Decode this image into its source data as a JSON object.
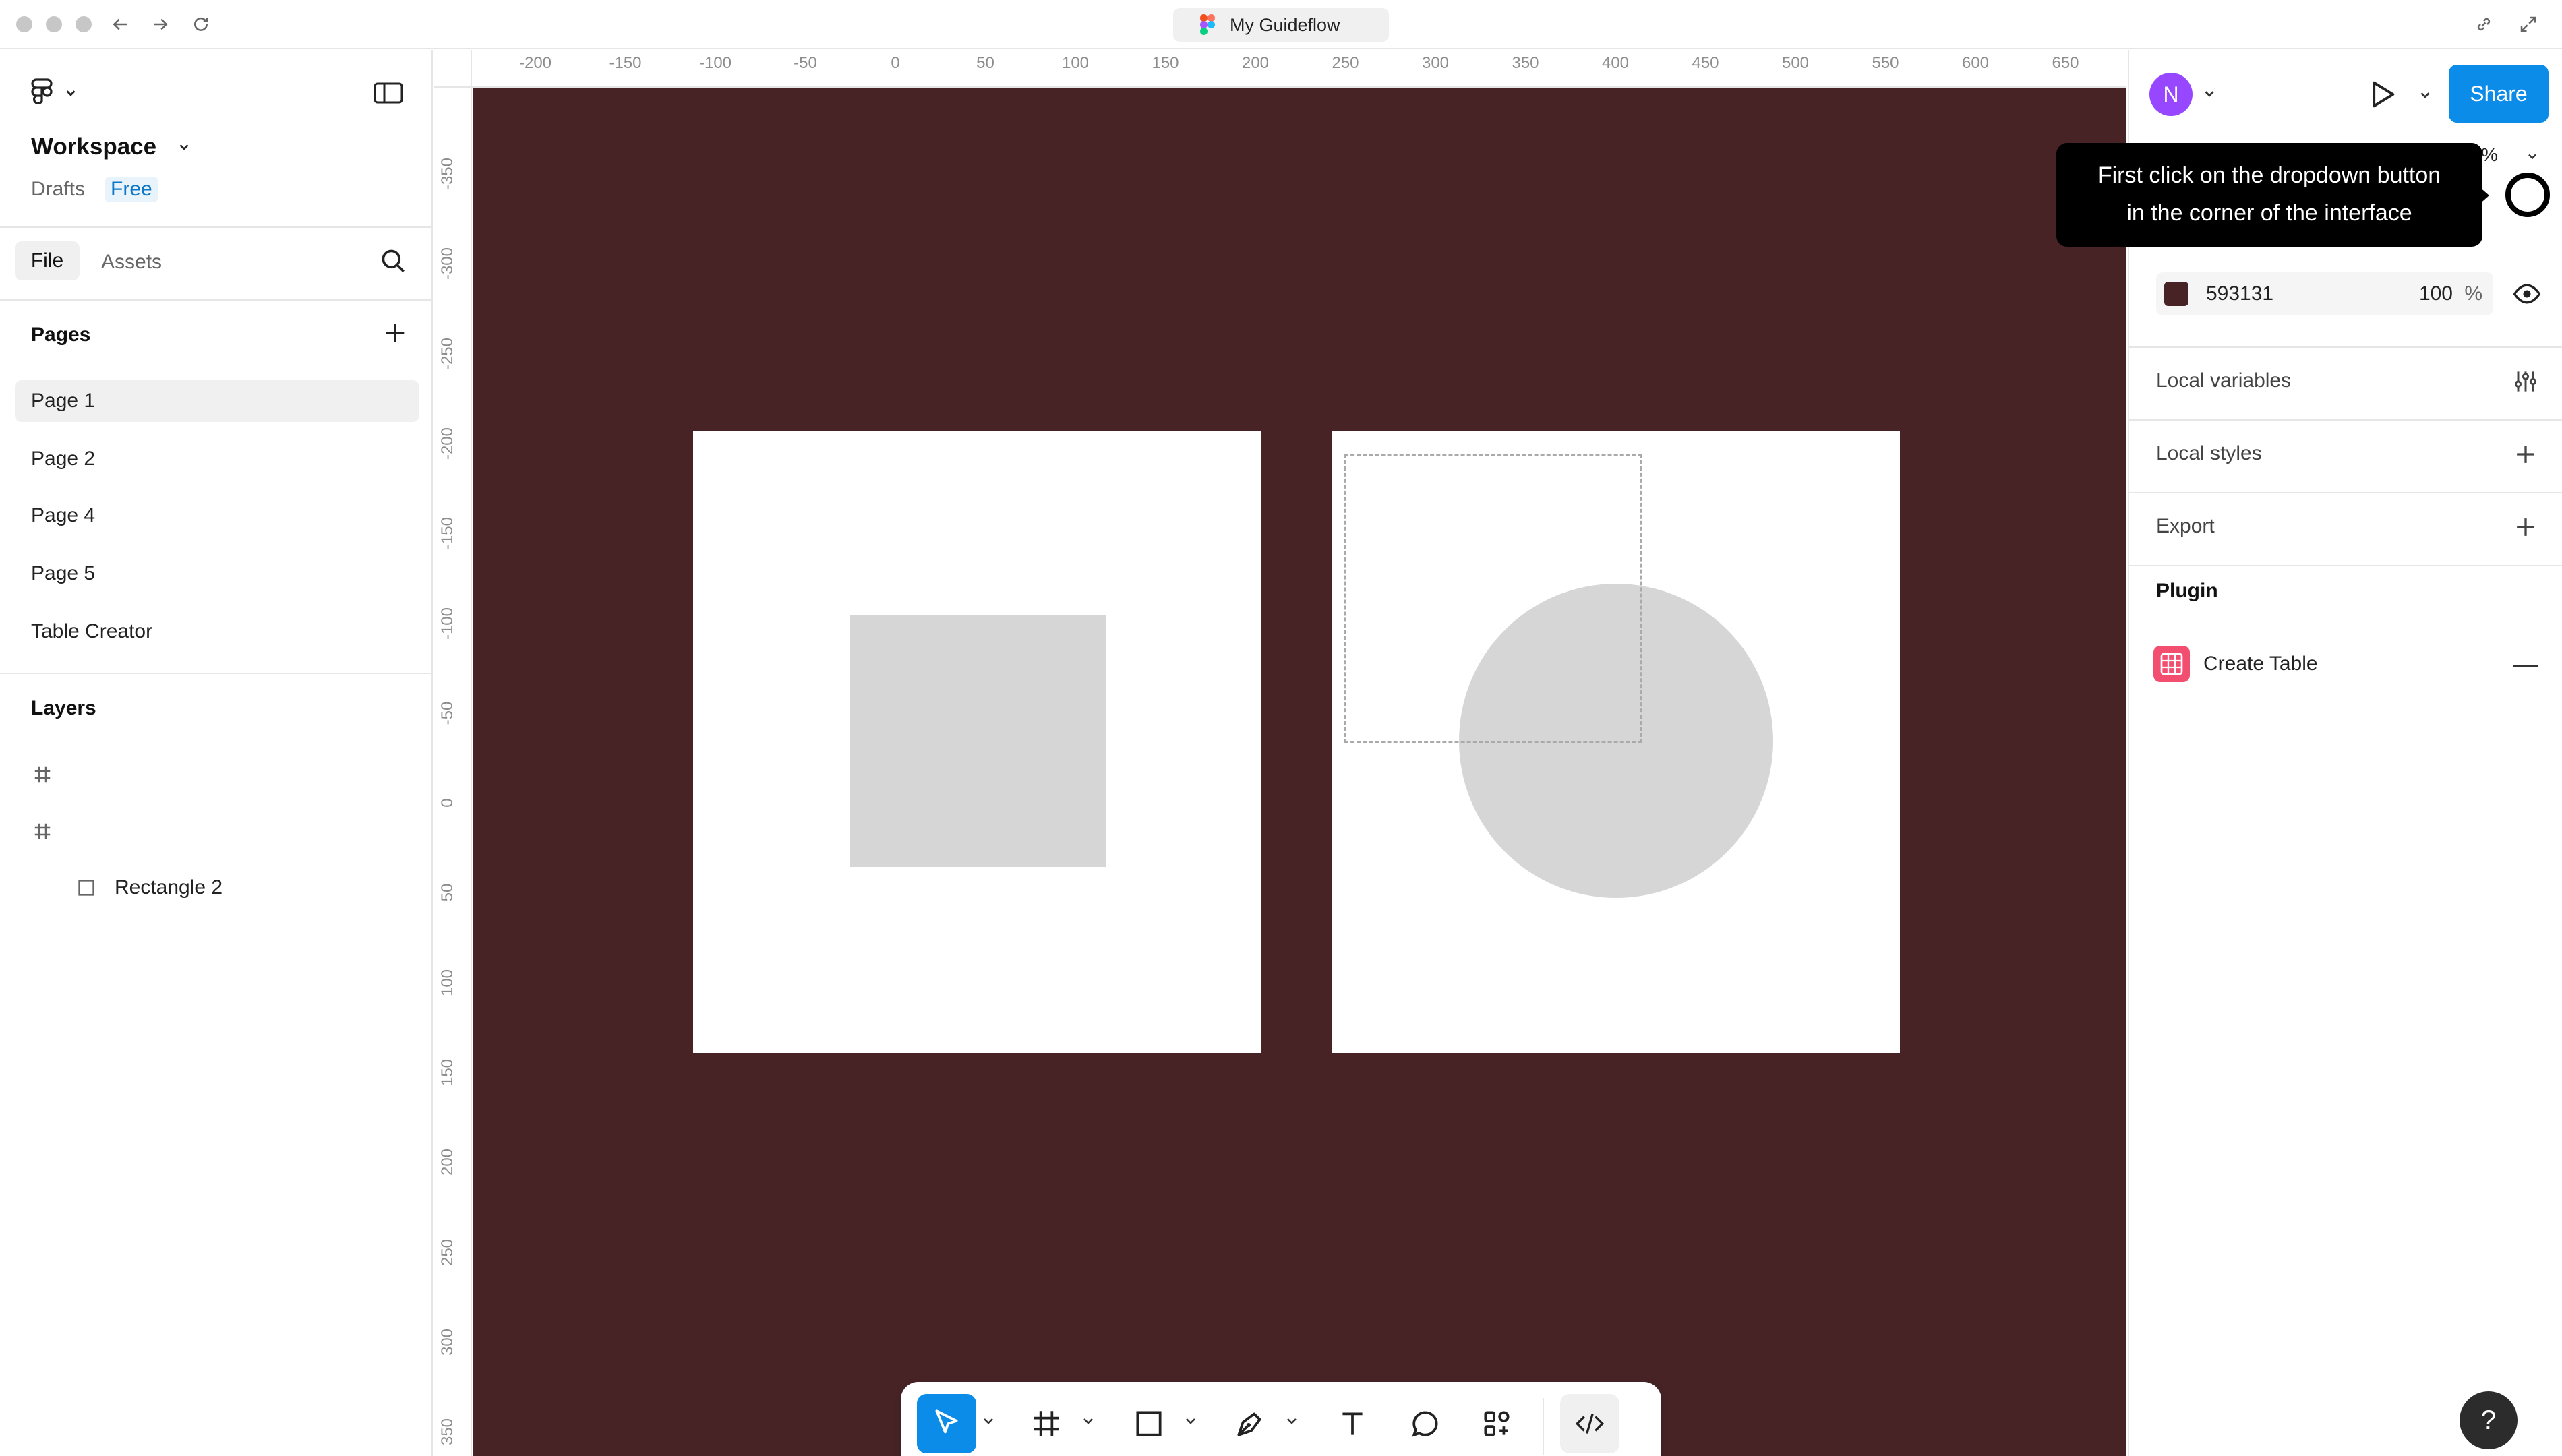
{
  "window": {
    "doc_title": "My Guideflow"
  },
  "left_panel": {
    "workspace_name": "Workspace",
    "drafts_label": "Drafts",
    "plan_badge": "Free",
    "tabs": {
      "file": "File",
      "assets": "Assets"
    },
    "pages_title": "Pages",
    "pages": [
      {
        "label": "Page 1",
        "active": true
      },
      {
        "label": "Page 2",
        "active": false
      },
      {
        "label": "Page 4",
        "active": false
      },
      {
        "label": "Page 5",
        "active": false
      },
      {
        "label": "Table Creator",
        "active": false
      }
    ],
    "layers_title": "Layers",
    "layers": [
      {
        "label": "",
        "icon": "frame-icon"
      },
      {
        "label": "",
        "icon": "frame-icon"
      },
      {
        "label": "Rectangle 2",
        "icon": "rectangle-icon"
      }
    ]
  },
  "rulers": {
    "x_ticks": [
      "-200",
      "-150",
      "-100",
      "-50",
      "0",
      "50",
      "100",
      "150",
      "200",
      "250",
      "300",
      "350",
      "400",
      "450",
      "500",
      "550",
      "600",
      "650"
    ],
    "y_ticks": [
      "-350",
      "-300",
      "-250",
      "-200",
      "-150",
      "-100",
      "-50",
      "0",
      "50",
      "100",
      "150",
      "200",
      "250",
      "300",
      "350"
    ]
  },
  "canvas": {
    "background": "#472326",
    "frame_color": "#ffffff",
    "shape_color": "#d6d6d6"
  },
  "right_panel": {
    "avatar_initial": "N",
    "avatar_color": "#9747ff",
    "share_label": "Share",
    "zoom_partial": "%",
    "fill": {
      "hex": "593131",
      "opacity": "100",
      "unit": "%",
      "swatch": "#472326"
    },
    "local_variables": "Local variables",
    "local_styles": "Local styles",
    "export": "Export",
    "plugin_title": "Plugin",
    "plugin_name": "Create Table"
  },
  "tooltip": {
    "line1": "First click on the dropdown button",
    "line2": "in the corner of the interface"
  },
  "help": {
    "label": "?"
  }
}
